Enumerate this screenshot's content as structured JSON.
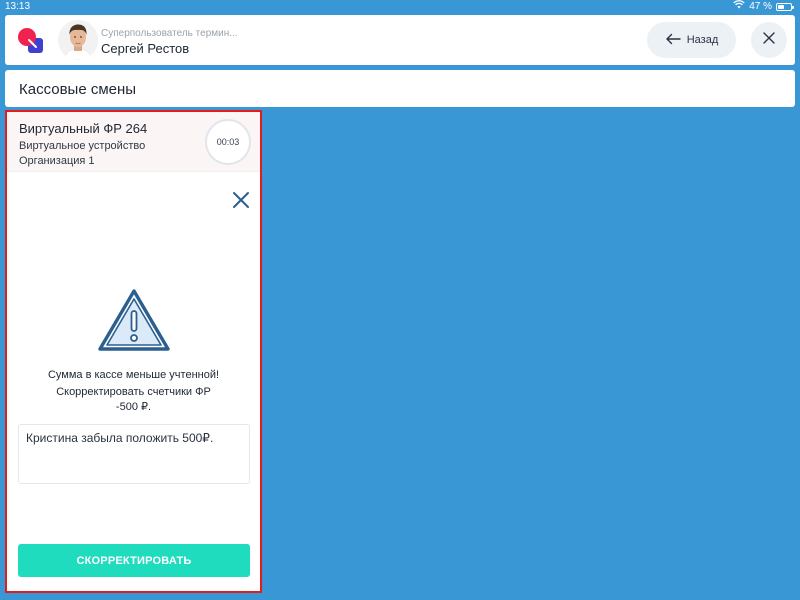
{
  "status_bar": {
    "time": "13:13",
    "battery": "47 %",
    "battery_level": 0.47
  },
  "header": {
    "user_role": "Суперпользователь термин...",
    "user_name": "Сергей Рестов",
    "back_label": "Назад"
  },
  "section": {
    "title": "Кассовые смены"
  },
  "card": {
    "device_title": "Виртуальный ФР 264",
    "device_subtitle": "Виртуальное устройство",
    "organization": "Организация 1",
    "timer": "00:03"
  },
  "dialog": {
    "message_line1": "Сумма в кассе меньше учтенной!",
    "message_line2": "Скорректировать счетчики ФР",
    "message_line3": "-500 ₽.",
    "comment": "Кристина забыла положить 500₽.",
    "action_label": "СКОРРЕКТИРОВАТЬ"
  },
  "colors": {
    "background": "#3a97d6",
    "accent_button": "#1fdcbf",
    "highlight_border": "#e31b1b",
    "icon_blue": "#2b5f8f"
  },
  "icons": [
    "wifi-icon",
    "battery-icon",
    "app-logo-icon",
    "arrow-left-icon",
    "close-icon",
    "warning-icon"
  ]
}
